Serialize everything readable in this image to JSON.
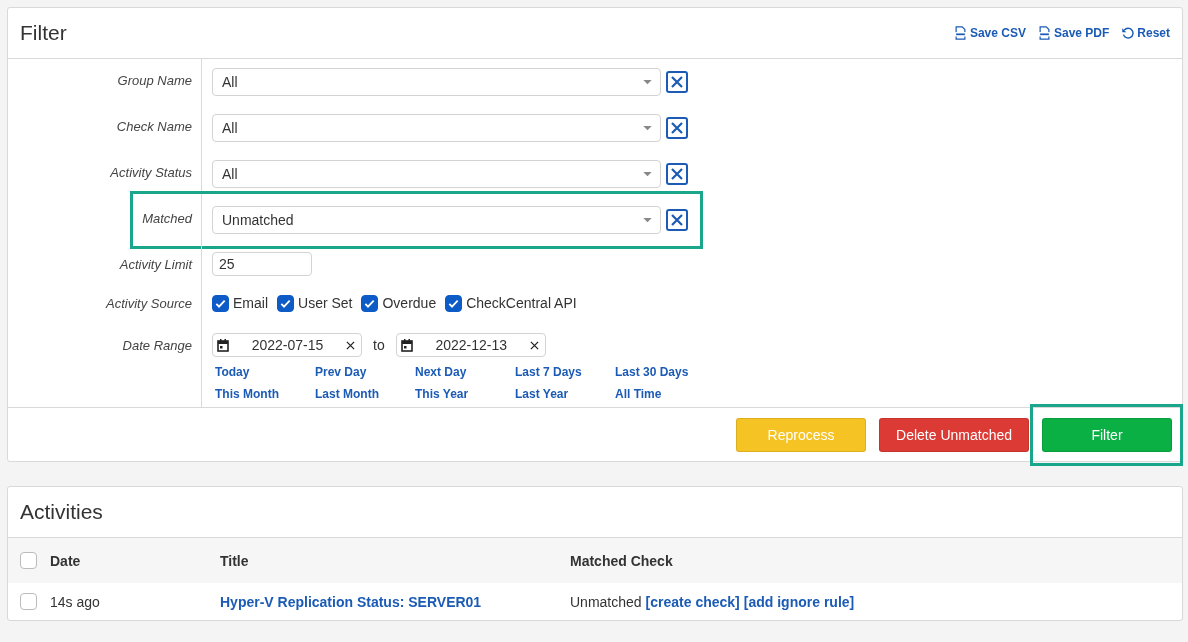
{
  "filter": {
    "title": "Filter",
    "actions": [
      {
        "kind": "csv",
        "label": "Save CSV"
      },
      {
        "kind": "pdf",
        "label": "Save PDF"
      },
      {
        "kind": "reset",
        "label": "Reset"
      }
    ],
    "fields": [
      {
        "kind": "select",
        "label": "Group Name",
        "value": "All",
        "highlighted": false
      },
      {
        "kind": "select",
        "label": "Check Name",
        "value": "All",
        "highlighted": false
      },
      {
        "kind": "select",
        "label": "Activity Status",
        "value": "All",
        "highlighted": false
      },
      {
        "kind": "select",
        "label": "Matched",
        "value": "Unmatched",
        "highlighted": true
      },
      {
        "kind": "text",
        "label": "Activity Limit",
        "value": "25"
      },
      {
        "kind": "checkboxes",
        "label": "Activity Source",
        "options": [
          {
            "label": "Email",
            "checked": true
          },
          {
            "label": "User Set",
            "checked": true
          },
          {
            "label": "Overdue",
            "checked": true
          },
          {
            "label": "CheckCentral API",
            "checked": true
          }
        ]
      },
      {
        "kind": "daterange",
        "label": "Date Range",
        "from": "2022-07-15",
        "separator": "to",
        "to": "2022-12-13",
        "presets": [
          "Today",
          "Prev Day",
          "Next Day",
          "Last 7 Days",
          "Last 30 Days",
          "This Month",
          "Last Month",
          "This Year",
          "Last Year",
          "All Time"
        ]
      }
    ],
    "buttons": [
      {
        "label": "Reprocess",
        "color": "#f6c324",
        "highlighted": false
      },
      {
        "label": "Delete Unmatched",
        "color": "#dc3a35",
        "highlighted": false
      },
      {
        "label": "Filter",
        "color": "#0bb044",
        "highlighted": true
      }
    ]
  },
  "activities": {
    "title": "Activities",
    "select_all_checked": false,
    "columns": [
      "Date",
      "Title",
      "Matched Check"
    ],
    "rows": [
      {
        "checked": false,
        "date": "14s ago",
        "title": "Hyper-V Replication Status: SERVER01",
        "status": "Unmatched",
        "links": [
          "[create check]",
          "[add ignore rule]"
        ]
      }
    ]
  }
}
